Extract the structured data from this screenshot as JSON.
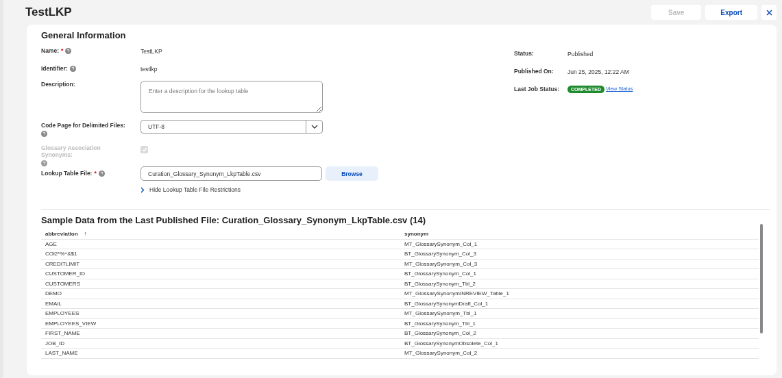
{
  "header": {
    "title": "TestLKP",
    "buttons": [
      {
        "label": "Save",
        "disabled": true
      },
      {
        "label": "Export",
        "disabled": false
      }
    ]
  },
  "general": {
    "title": "General Information",
    "fields": [
      {
        "kind": "text",
        "label": "Name:",
        "required_mark": "*",
        "help": true,
        "value": "TestLKP"
      },
      {
        "kind": "text",
        "label": "Identifier:",
        "help": true,
        "value": "testlkp"
      },
      {
        "kind": "textarea",
        "label": "Description:",
        "help": false,
        "placeholder": "Enter a description for the lookup table"
      },
      {
        "kind": "select",
        "label": "Code Page for Delimited Files:",
        "help": true,
        "value": "UTF-8"
      },
      {
        "kind": "checkbox",
        "label": "Glossary Association Synonyms:",
        "help": true,
        "disabled": true,
        "checked": true
      },
      {
        "kind": "file",
        "label": "Lookup Table File:",
        "required_mark": "*",
        "help": true,
        "value": "Curation_Glossary_Synonym_LkpTable.csv",
        "button": "Browse"
      }
    ],
    "restrictions_link": "Hide Lookup Table File Restrictions",
    "status": [
      {
        "kind": "text",
        "label": "Status:",
        "value": "Published"
      },
      {
        "kind": "text",
        "label": "Published On:",
        "value": "Jun 25, 2025, 12:22 AM"
      },
      {
        "kind": "badge",
        "label": "Last Job Status:",
        "value": "COMPLETED",
        "link": "View Status"
      }
    ]
  },
  "sample": {
    "title": "Sample Data from the Last Published File: Curation_Glossary_Synonym_LkpTable.csv (14)",
    "columns": [
      {
        "label": "abbreviation",
        "sort": "↑"
      },
      {
        "label": "synonym"
      }
    ],
    "rows": [
      [
        "AGE",
        "MT_GlossarySynonym_Col_1"
      ],
      [
        "COl2*%^&$1",
        "BT_GlossarySynonym_Col_3"
      ],
      [
        "CREDITLIMIT",
        "MT_GlossarySynonym_Col_3"
      ],
      [
        "CUSTOMER_ID",
        "BT_GlossarySynonym_Col_1"
      ],
      [
        "CUSTOMERS",
        "BT_GlossarySynonym_Tbl_2"
      ],
      [
        "DEMO",
        "MT_GlossarySynonymINREVIEW_Table_1"
      ],
      [
        "EMAIL",
        "BT_GlossarySynonymDraft_Col_1"
      ],
      [
        "EMPLOYEES",
        "MT_GlossarySynonym_Tbl_1"
      ],
      [
        "EMPLOYEES_VIEW",
        "BT_GlossarySynonym_Tbl_1"
      ],
      [
        "FIRST_NAME",
        "BT_GlossarySynonym_Col_2"
      ],
      [
        "JOB_ID",
        "BT_GlossarySynonymObsolete_Col_1"
      ],
      [
        "LAST_NAME",
        "MT_GlossarySynonym_Col_2"
      ]
    ]
  }
}
